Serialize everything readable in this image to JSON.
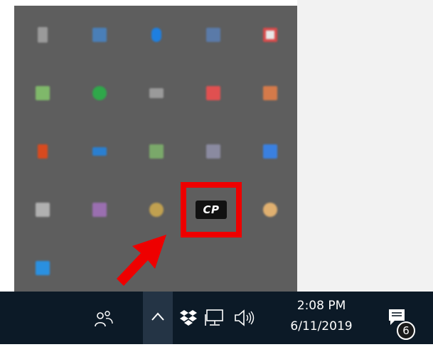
{
  "tray_flyout": {
    "icons": [
      {
        "name": "tray-icon-1",
        "color": "#9a9a9a"
      },
      {
        "name": "tray-icon-2",
        "color": "#4a7fb8"
      },
      {
        "name": "tray-icon-3",
        "color": "#1e7fe0"
      },
      {
        "name": "tray-icon-4",
        "color": "#5a7aa8"
      },
      {
        "name": "tray-icon-5",
        "color": "#d84a4a"
      },
      {
        "name": "tray-icon-6",
        "color": "#7fb86a"
      },
      {
        "name": "tray-icon-7",
        "color": "#2fa84a"
      },
      {
        "name": "tray-icon-8",
        "color": "#9a9a9a"
      },
      {
        "name": "tray-icon-9",
        "color": "#e05050"
      },
      {
        "name": "tray-icon-10",
        "color": "#d47a4a"
      },
      {
        "name": "tray-icon-11",
        "color": "#d84a1e"
      },
      {
        "name": "tray-icon-12",
        "color": "#2a7fd0"
      },
      {
        "name": "tray-icon-13",
        "color": "#7aa86a"
      },
      {
        "name": "tray-icon-14",
        "color": "#8a8aa0"
      },
      {
        "name": "tray-icon-15",
        "color": "#3a80e0"
      },
      {
        "name": "tray-icon-16",
        "color": "#b0b0b0"
      },
      {
        "name": "tray-icon-17",
        "color": "#9a6fb0"
      },
      {
        "name": "tray-icon-18",
        "color": "#c0a050"
      },
      {
        "name": "cp-tray-icon",
        "color": "#111111"
      },
      {
        "name": "tray-icon-20",
        "color": "#e0b070"
      },
      {
        "name": "tray-icon-21",
        "color": "#2a90e0"
      }
    ],
    "cp_label": "CP",
    "highlight_color": "#ee0000"
  },
  "taskbar": {
    "time": "2:08 PM",
    "date": "6/11/2019",
    "notification_count": "6",
    "background": "#0c1a27"
  }
}
